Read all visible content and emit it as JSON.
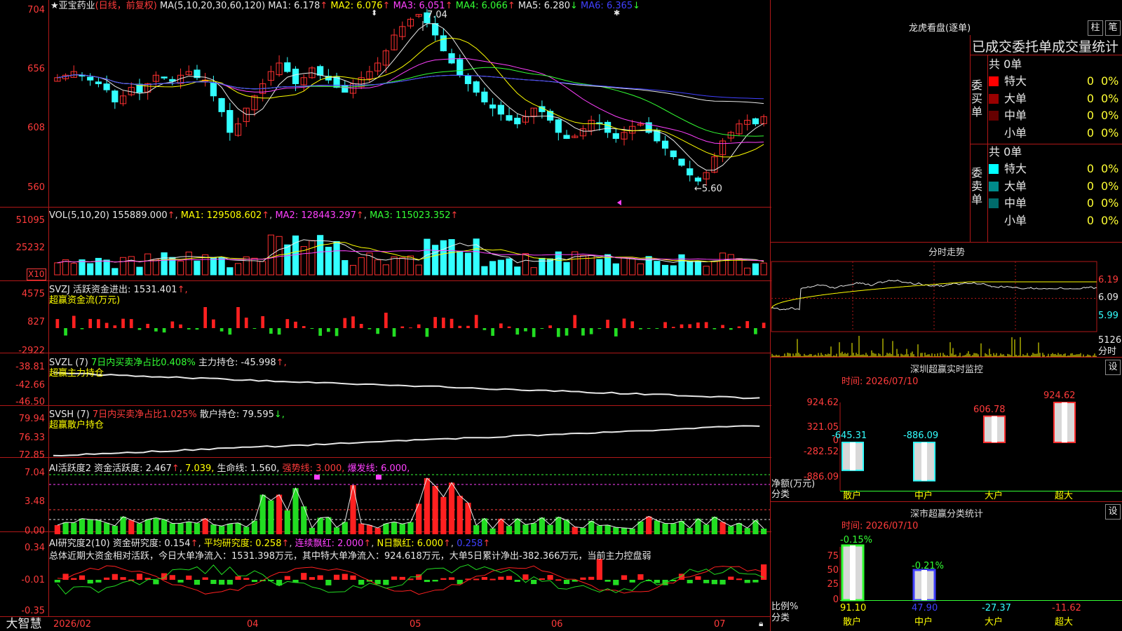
{
  "stock": {
    "star": "★",
    "name": "亚宝药业",
    "mode": "(日线，前复权)"
  },
  "ma_header": {
    "label": "MA(5,10,20,30,60,120)",
    "items": [
      {
        "name": "MA1:",
        "value": "6.178",
        "arrow": "↑",
        "color": "#e8e8e8"
      },
      {
        "name": "MA2:",
        "value": "6.076",
        "arrow": "↑",
        "color": "#ffff00"
      },
      {
        "name": "MA3:",
        "value": "6.051",
        "arrow": "↑",
        "color": "#ff40ff"
      },
      {
        "name": "MA4:",
        "value": "6.066",
        "arrow": "↑",
        "color": "#33ff33"
      },
      {
        "name": "MA5:",
        "value": "6.280",
        "arrow": "↓",
        "color": "#e8e8e8"
      },
      {
        "name": "MA6:",
        "value": "6.365",
        "arrow": "↓",
        "color": "#4040ff"
      }
    ]
  },
  "price_axis": [
    "704",
    "656",
    "608",
    "560"
  ],
  "price_annotations": {
    "high": "7.04",
    "low": "←5.60"
  },
  "vol": {
    "label": "VOL(5,10,20)",
    "value": "155889.000",
    "arrow": "↑",
    "ma1": "MA1: 129508.602",
    "ma2": "MA2: 128443.297",
    "ma3": "MA3: 115023.352",
    "axis": [
      "51095",
      "25232"
    ],
    "unit": "X10"
  },
  "svzj": {
    "label": "SVZJ",
    "desc": "活跃资金进出: 1531.401",
    "arrow": "↑,",
    "sub": "超赢资金流(万元)",
    "axis": [
      "4575",
      "827",
      "-2922"
    ]
  },
  "svzl": {
    "label": "SVZL (7)",
    "desc1": "7日内买卖净占比0.408%",
    "desc2": "主力持仓: -45.998",
    "arrow": "↑,",
    "sub": "超赢主力持仓",
    "axis": [
      "-38.81",
      "-42.66",
      "-46.50"
    ]
  },
  "svsh": {
    "label": "SVSH (7)",
    "desc1": "7日内买卖净占比1.025%",
    "desc2": "散户持仓: 79.595",
    "arrow": "↓,",
    "sub": "超赢散户持仓",
    "axis": [
      "79.94",
      "76.33",
      "72.85"
    ]
  },
  "ai1": {
    "label": "AI活跃度2",
    "items": [
      "资金活跃度: 2.467",
      "7.039,",
      "生命线: 1.560,",
      "强势线: 3.000,",
      "爆发线: 6.000,"
    ],
    "axis": [
      "7.04",
      "3.48",
      "0.00"
    ]
  },
  "ai2": {
    "label": "AI研究度2(10)",
    "items": [
      "资金研究度: 0.154",
      "平均研究度: 0.258",
      "连续飘红: 2.000",
      "N日飘红: 6.000",
      "0.258"
    ],
    "summary": "总体近期大资金相对活跃，今日大单净流入：1531.398万元，其中特大单净流入：924.618万元，大单5日累计净出-382.366万元，当前主力控盘弱",
    "axis": [
      "0.34",
      "-0.01",
      "-0.35"
    ]
  },
  "time_axis": [
    "2026/02",
    "04",
    "05",
    "06",
    "07"
  ],
  "app_brand": "大智慧",
  "right": {
    "lhb_title": "龙虎看盘(逐单)",
    "btn_bar": "柱",
    "btn_pen": "笔",
    "order_title": "已成交委托单成交量统计",
    "buy": {
      "side": "委买单",
      "total": "共 0单",
      "rows": [
        {
          "label": "特大",
          "count": "0",
          "pct": "0%",
          "color": "#ff0000"
        },
        {
          "label": "大单",
          "count": "0",
          "pct": "0%",
          "color": "#990000"
        },
        {
          "label": "中单",
          "count": "0",
          "pct": "0%",
          "color": "#660000"
        },
        {
          "label": "小单",
          "count": "0",
          "pct": "0%",
          "color": "#000000"
        }
      ]
    },
    "sell": {
      "side": "委卖单",
      "total": "共 0单",
      "rows": [
        {
          "label": "特大",
          "count": "0",
          "pct": "0%",
          "color": "#00ffff"
        },
        {
          "label": "大单",
          "count": "0",
          "pct": "0%",
          "color": "#008b8b"
        },
        {
          "label": "中单",
          "count": "0",
          "pct": "0%",
          "color": "#006b6b"
        },
        {
          "label": "小单",
          "count": "0",
          "pct": "0%",
          "color": "#000000"
        }
      ]
    },
    "intraday_title": "分时走势",
    "intraday_axis": [
      "6.19",
      "6.09",
      "5.99"
    ],
    "intraday_vol": "5126",
    "intraday_unit": "分时",
    "sz_title": "深圳超赢实时监控",
    "sz_settings": "设",
    "sz_time": "时间: 2026/07/10",
    "sz_axis": [
      "924.62",
      "321.05",
      "0",
      "-282.52",
      "-886.09"
    ],
    "sz_axis_label": "净额(万元)",
    "sz_cat_label": "分类",
    "sz_cats": [
      "散户",
      "中户",
      "大户",
      "超大"
    ],
    "sz_values": [
      "-645.31",
      "-886.09",
      "606.78",
      "924.62"
    ],
    "cls_title": "深市超赢分类统计",
    "cls_settings": "设",
    "cls_time": "时间: 2026/07/10",
    "cls_axis": [
      "75",
      "50",
      "25",
      "0"
    ],
    "cls_top": [
      "-0.15%",
      "-0.21%"
    ],
    "cls_bottom": [
      "91.10",
      "47.90",
      "-27.37",
      "-11.62"
    ],
    "cls_axis_label": "比例%",
    "cls_cat_label": "分类",
    "cls_cats": [
      "散户",
      "中户",
      "大户",
      "超大"
    ]
  },
  "chart_data": [
    {
      "type": "candlestick",
      "title": "亚宝药业 (日线，前复权)",
      "yaxis_ticks": [
        7.04,
        6.56,
        6.08,
        5.6
      ],
      "high": 7.04,
      "low": 5.6,
      "x_ticks": [
        "2026/02",
        "04",
        "05",
        "06",
        "07"
      ],
      "close_series": [
        6.5,
        6.52,
        6.55,
        6.52,
        6.48,
        6.45,
        6.4,
        6.3,
        6.35,
        6.42,
        6.38,
        6.45,
        6.52,
        6.5,
        6.47,
        6.52,
        6.55,
        6.5,
        6.48,
        6.35,
        6.22,
        6.05,
        6.12,
        6.25,
        6.35,
        6.45,
        6.55,
        6.62,
        6.55,
        6.45,
        6.5,
        6.58,
        6.52,
        6.48,
        6.42,
        6.38,
        6.45,
        6.5,
        6.55,
        6.62,
        6.72,
        6.85,
        6.92,
        6.98,
        7.02,
        6.95,
        6.85,
        6.72,
        6.62,
        6.52,
        6.45,
        6.38,
        6.3,
        6.25,
        6.2,
        6.15,
        6.12,
        6.18,
        6.25,
        6.22,
        6.15,
        6.05,
        6.0,
        6.02,
        6.08,
        6.15,
        6.12,
        6.05,
        6.0,
        6.05,
        6.1,
        6.12,
        6.05,
        5.98,
        5.92,
        5.85,
        5.78,
        5.7,
        5.65,
        5.72,
        5.85,
        5.98,
        6.05,
        6.12,
        6.15,
        6.12,
        6.18
      ]
    },
    {
      "type": "bar",
      "title": "VOL(5,10,20)",
      "last": 155889.0
    },
    {
      "type": "bar",
      "title": "深圳超赢实时监控",
      "categories": [
        "散户",
        "中户",
        "大户",
        "超大"
      ],
      "values": [
        -645.31,
        -886.09,
        606.78,
        924.62
      ],
      "ylim": [
        -886.09,
        924.62
      ]
    },
    {
      "type": "bar",
      "title": "深市超赢分类统计",
      "categories": [
        "散户",
        "中户",
        "大户",
        "超大"
      ],
      "values": [
        91.1,
        47.9,
        -27.37,
        -11.62
      ]
    }
  ]
}
